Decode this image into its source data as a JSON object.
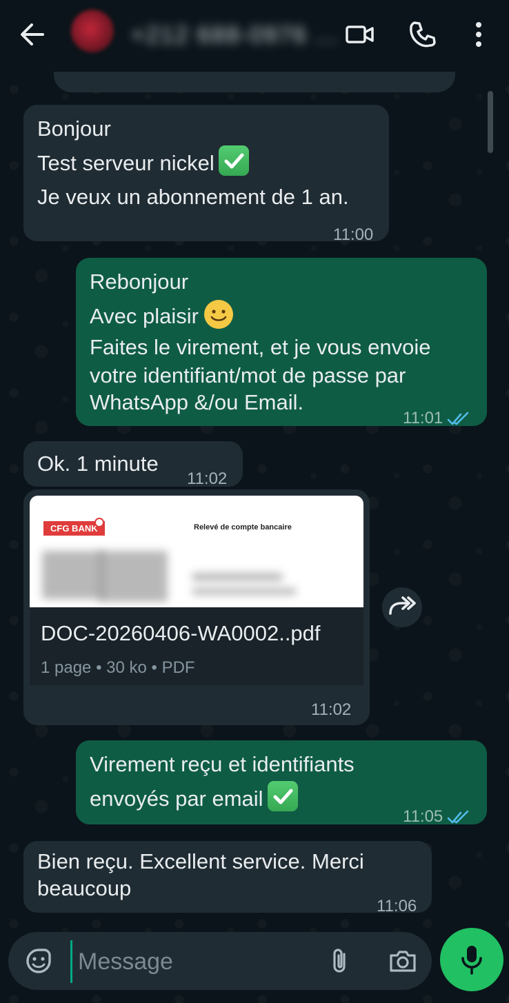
{
  "header": {
    "contact_name": "+212 688-0976 ..."
  },
  "messages": [
    {
      "lines": [
        "Bonjour",
        "Test serveur nickel",
        "Je veux un abonnement de 1 an."
      ],
      "time": "11:00"
    },
    {
      "lines": [
        "Rebonjour",
        "Avec plaisir",
        "Faites le virement, et je vous envoie",
        "votre identifiant/mot de passe par",
        "WhatsApp &/ou Email."
      ],
      "time": "11:01"
    },
    {
      "lines": [
        "Ok. 1 minute"
      ],
      "time": "11:02"
    },
    {
      "lines": [
        "Virement reçu et identifiants",
        "envoyés par email"
      ],
      "time": "11:05"
    },
    {
      "lines": [
        "Bien reçu. Excellent service. Merci",
        "beaucoup"
      ],
      "time": "11:06"
    }
  ],
  "document": {
    "bank_logo": "CFG BANK",
    "heading": "Relevé de compte bancaire",
    "filename": "DOC-20260406-WA0002..pdf",
    "meta": "1 page • 30 ko • PDF",
    "time": "11:02"
  },
  "composer": {
    "placeholder": "Message"
  },
  "colors": {
    "background": "#0b141a",
    "incoming_bubble": "#202c33",
    "outgoing_bubble": "#0f5c45",
    "read_ticks": "#53bdeb",
    "mic_button": "#21c063"
  },
  "icons": [
    "back-arrow-icon",
    "video-call-icon",
    "voice-call-icon",
    "more-options-icon",
    "forward-icon",
    "sticker-icon",
    "attach-clip-icon",
    "camera-icon",
    "mic-icon",
    "check-mark-emoji",
    "smile-emoji",
    "double-check-icon"
  ]
}
